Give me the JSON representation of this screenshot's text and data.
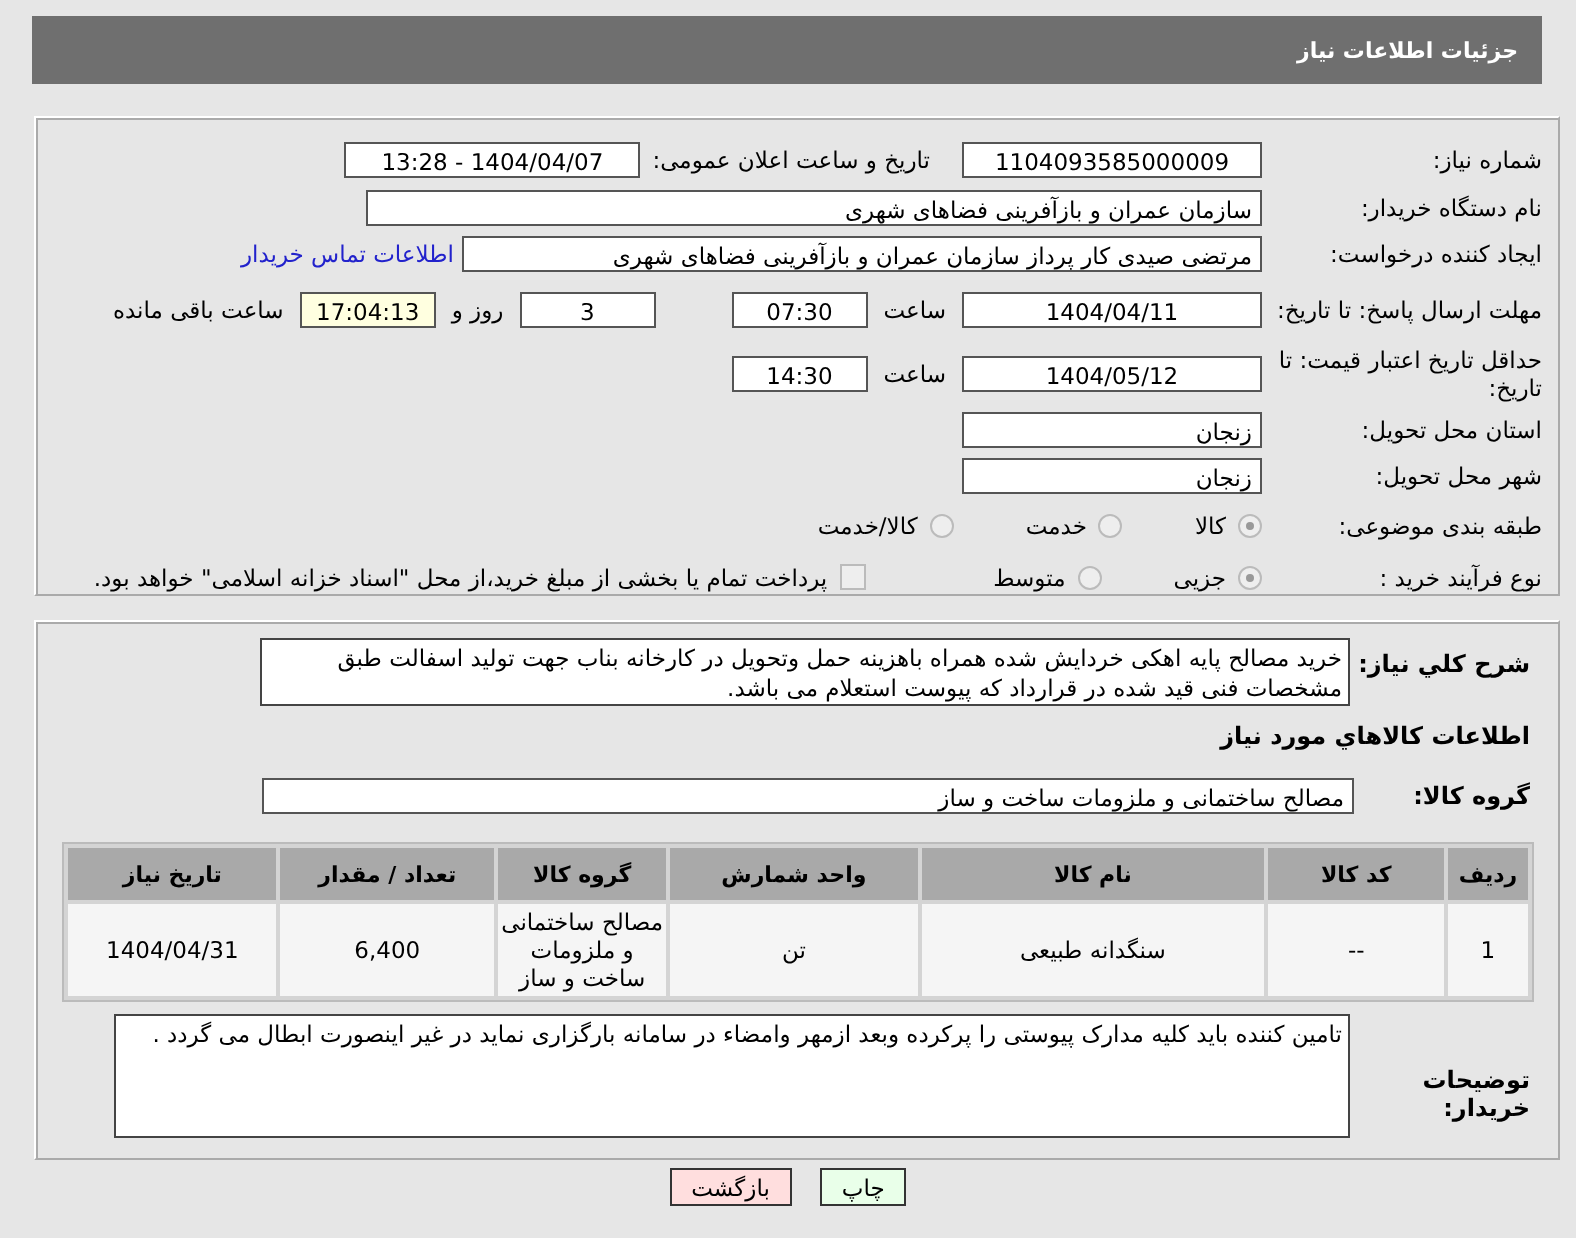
{
  "header": {
    "title": "جزئیات اطلاعات نیاز"
  },
  "need_number": {
    "label": "شماره نیاز:",
    "value": "1104093585000009"
  },
  "announce": {
    "label": "تاریخ و ساعت اعلان عمومی:",
    "value": "1404/04/07 - 13:28"
  },
  "buyer_org": {
    "label": "نام دستگاه خریدار:",
    "value": "سازمان عمران و بازآفرینی فضاهای شهری"
  },
  "creator": {
    "label": "ایجاد کننده درخواست:",
    "value": "مرتضی  صیدی  کار پرداز سازمان عمران و بازآفرینی فضاهای شهری",
    "link": "اطلاعات تماس خریدار"
  },
  "reply_deadline": {
    "label": "مهلت ارسال پاسخ: تا تاریخ:",
    "date": "1404/04/11",
    "time_label": "ساعت",
    "time": "07:30",
    "days": "3",
    "days_label": "روز و",
    "remaining": "17:04:13",
    "remaining_label": "ساعت باقی مانده"
  },
  "price_validity": {
    "label": "حداقل تاریخ اعتبار قیمت: تا تاریخ:",
    "date": "1404/05/12",
    "time_label": "ساعت",
    "time": "14:30"
  },
  "province": {
    "label": "استان محل تحویل:",
    "value": "زنجان"
  },
  "city": {
    "label": "شهر محل تحویل:",
    "value": "زنجان"
  },
  "subject_category": {
    "label": "طبقه بندی موضوعی:",
    "options": [
      {
        "label": "کالا",
        "selected": true
      },
      {
        "label": "خدمت",
        "selected": false
      },
      {
        "label": "کالا/خدمت",
        "selected": false
      }
    ]
  },
  "purchase_process": {
    "label": "نوع فرآیند خرید :",
    "options": [
      {
        "label": "جزیی",
        "selected": true
      },
      {
        "label": "متوسط",
        "selected": false
      }
    ],
    "payment_option": {
      "label": "پرداخت تمام یا بخشی از مبلغ خرید،از محل \"اسناد خزانه اسلامی\" خواهد بود.",
      "checked": false
    }
  },
  "description": {
    "label": "شرح کلي نياز:",
    "value": "خرید مصالح پایه اهکی خردایش شده همراه باهزینه حمل وتحویل در کارخانه بناب جهت تولید اسفالت طبق مشخصات فنی قید شده در قرارداد که پیوست استعلام می باشد."
  },
  "goods_heading": "اطلاعات كالاهاي مورد نياز",
  "goods_group": {
    "label": "گروه كالا:",
    "value": "مصالح ساختمانی و ملزومات ساخت و ساز"
  },
  "table": {
    "columns": [
      "ردیف",
      "کد کالا",
      "نام کالا",
      "واحد شمارش",
      "گروه کالا",
      "تعداد / مقدار",
      "تاریخ نیاز"
    ],
    "rows": [
      [
        "1",
        "--",
        "سنگدانه طبیعی",
        "تن",
        "مصالح ساختمانی و ملزومات ساخت و ساز",
        "6,400",
        "1404/04/31"
      ]
    ]
  },
  "buyer_notes": {
    "label": "توضیحات خریدار:",
    "value": "تامین کننده باید کلیه مدارک پیوستی را پرکرده وبعد ازمهر وامضاء در سامانه بارگزاری نماید در غیر اینصورت ابطال می گردد ."
  },
  "buttons": [
    {
      "label": "چاپ",
      "kind": "print"
    },
    {
      "label": "بازگشت",
      "kind": "back"
    }
  ]
}
